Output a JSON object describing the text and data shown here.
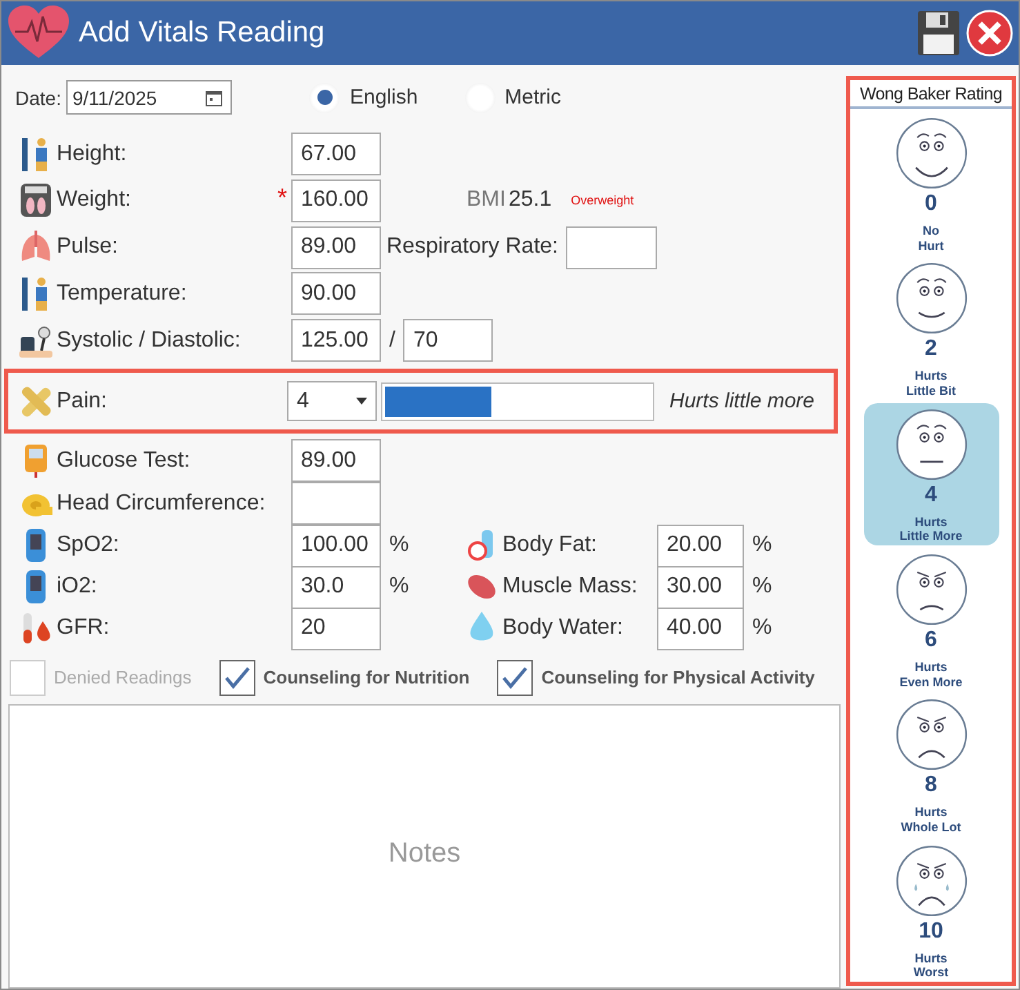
{
  "window": {
    "title": "Add Vitals Reading"
  },
  "date": {
    "label": "Date:",
    "value": "9/11/2025"
  },
  "units": [
    {
      "label": "English",
      "selected": true
    },
    {
      "label": "Metric",
      "selected": false
    }
  ],
  "vitals": [
    {
      "label": "Height:",
      "value": "67.00"
    },
    {
      "label": "Weight:",
      "value": "160.00",
      "required_mark": "*",
      "bmi": {
        "label": "BMI",
        "value": "25.1",
        "status": "Overweight"
      }
    },
    {
      "label": "Pulse:",
      "value": "89.00",
      "extra_label": "Respiratory Rate:"
    },
    {
      "label": "Temperature:",
      "value": "90.00"
    },
    {
      "label": "Systolic / Diastolic:",
      "value": "125.00",
      "separator": "/",
      "second_value": "70"
    }
  ],
  "pain": {
    "label": "Pain:",
    "value": "4",
    "level": 0.4,
    "description": "Hurts little more"
  },
  "more_vitals": [
    {
      "label": "Glucose Test:",
      "value": "89.00"
    },
    {
      "label": "Head Circumference:"
    }
  ],
  "measurements": [
    {
      "label": "SpO2:",
      "value": "100.00",
      "unit": "%"
    },
    {
      "label": "iO2:",
      "value": "30.0",
      "unit": "%"
    },
    {
      "label": "GFR:",
      "value": "20"
    }
  ],
  "body_composition": [
    {
      "label": "Body Fat:",
      "value": "20.00",
      "unit": "%"
    },
    {
      "label": "Muscle Mass:",
      "value": "30.00",
      "unit": "%"
    },
    {
      "label": "Body Water:",
      "value": "40.00",
      "unit": "%"
    }
  ],
  "checkboxes": [
    {
      "label": "Denied Readings",
      "checked": false,
      "disabled": true
    },
    {
      "label": "Counseling for Nutrition",
      "checked": true,
      "disabled": false
    },
    {
      "label": "Counseling for Physical Activity",
      "checked": true,
      "disabled": false
    }
  ],
  "notes": {
    "placeholder": "Notes"
  },
  "pain_scale": {
    "title": "Wong Baker Rating",
    "faces": [
      {
        "score": "0",
        "caption": "No\nHurt",
        "selected": false
      },
      {
        "score": "2",
        "caption": "Hurts\nLittle Bit",
        "selected": false
      },
      {
        "score": "4",
        "caption": "Hurts\nLittle More",
        "selected": true
      },
      {
        "score": "6",
        "caption": "Hurts\nEven More",
        "selected": false
      },
      {
        "score": "8",
        "caption": "Hurts\nWhole Lot",
        "selected": false
      },
      {
        "score": "10",
        "caption": "Hurts\nWorst",
        "selected": false
      }
    ]
  }
}
